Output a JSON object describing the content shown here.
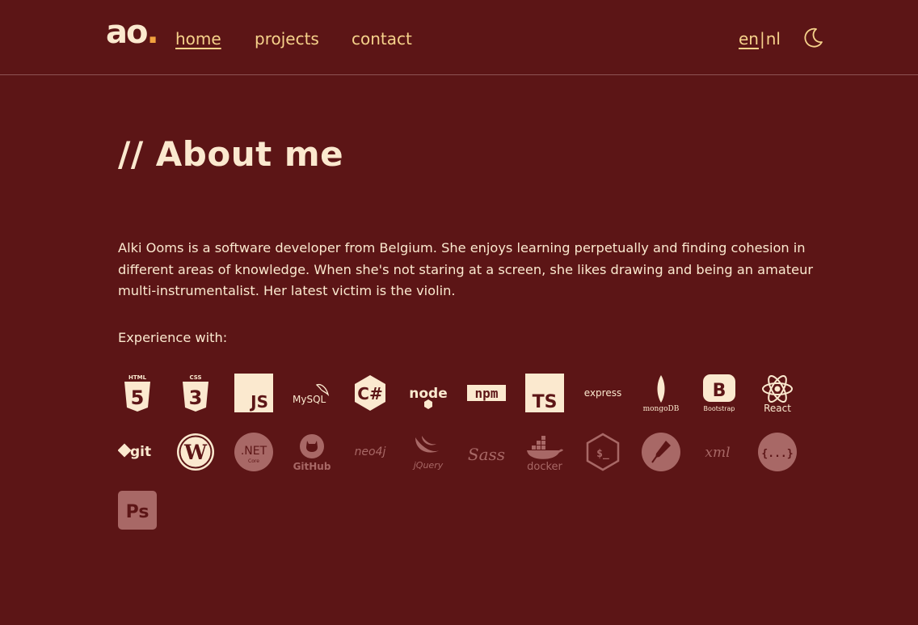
{
  "logo": {
    "letters": "ao",
    "dot": "."
  },
  "nav": {
    "home": "home",
    "projects": "projects",
    "contact": "contact"
  },
  "lang": {
    "en": "en",
    "separator": "|",
    "nl": "nl"
  },
  "theme_toggle": {
    "icon": "moon-icon"
  },
  "page": {
    "title": "// About me",
    "bio": "Alki Ooms is a software developer from Belgium. She enjoys learning perpetually and finding cohesion in different areas of knowledge. When she's not staring at a screen, she likes drawing and being an amateur multi-instrumentalist. Her latest victim is the violin.",
    "experience_label": "Experience with:"
  },
  "skills": {
    "html5": {
      "label": "HTML",
      "glyph": "5"
    },
    "css3": {
      "label": "CSS",
      "glyph": "3"
    },
    "javascript": {
      "label": "JS"
    },
    "mysql": {
      "label": "MySQL"
    },
    "csharp": {
      "label": "C#"
    },
    "node": {
      "label": "node"
    },
    "npm": {
      "label": "npm"
    },
    "typescript": {
      "label": "TS"
    },
    "express": {
      "label": "express"
    },
    "mongodb": {
      "label": "mongoDB"
    },
    "bootstrap": {
      "glyph": "B",
      "label": "Bootstrap"
    },
    "react": {
      "label": "React"
    },
    "git": {
      "label": "git"
    },
    "wordpress": {
      "glyph": "W"
    },
    "dotnet": {
      "label": ".NET",
      "sublabel": "Core"
    },
    "github": {
      "label": "GitHub"
    },
    "neo4j": {
      "label": "neo4j"
    },
    "jquery": {
      "label": "jQuery"
    },
    "sass": {
      "label": "Sass"
    },
    "docker": {
      "label": "docker"
    },
    "shell": {
      "label": "$_"
    },
    "postman": {
      "icon": "postman-icon"
    },
    "xml": {
      "label": "xml"
    },
    "json": {
      "label": "{...}"
    },
    "photoshop": {
      "label": "Ps"
    }
  },
  "colors": {
    "background": "#5c1516",
    "text": "#fbe9cf",
    "accent": "#f6d28b",
    "logo_dot": "#f2a23f",
    "muted_icon": "#a86866"
  }
}
